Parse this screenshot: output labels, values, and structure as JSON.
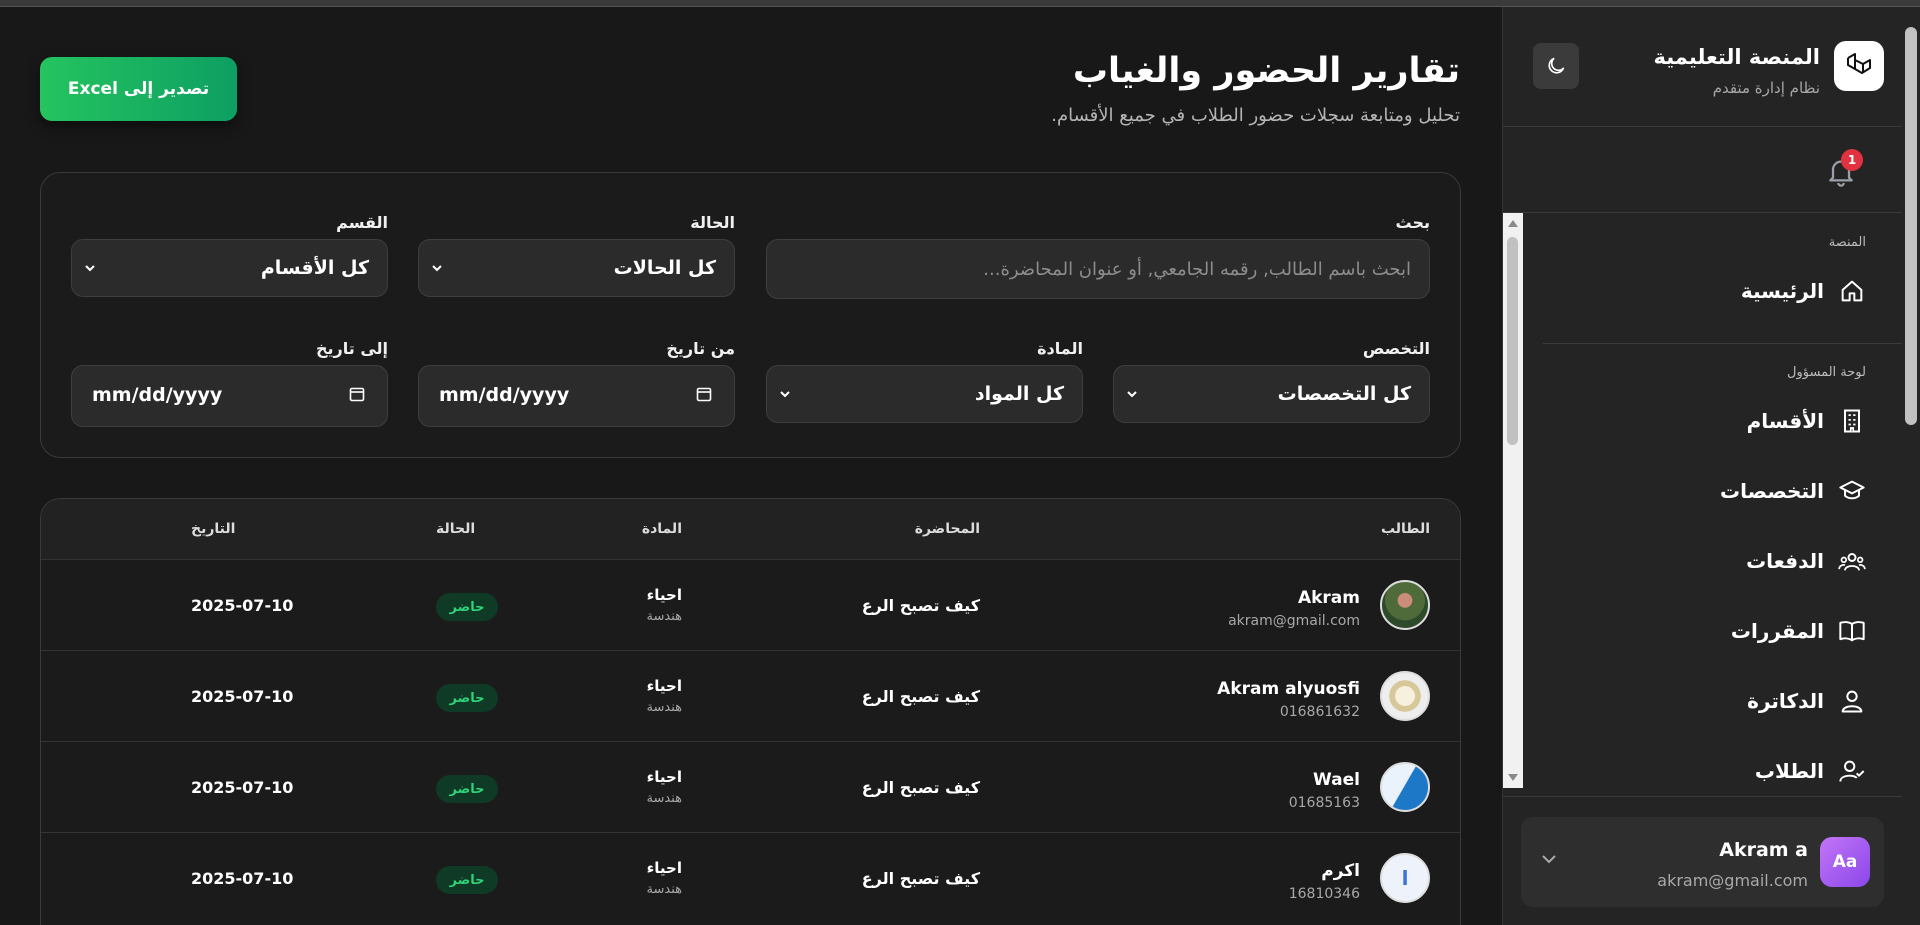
{
  "app": {
    "brand_title": "المنصة التعليمية",
    "brand_subtitle": "نظام إدارة متقدم",
    "notification_count": "1"
  },
  "nav": {
    "section_platform": "المنصة",
    "home": "الرئيسية",
    "section_admin": "لوحة المسؤول",
    "departments": "الأقسام",
    "specializations": "التخصصات",
    "batches": "الدفعات",
    "courses": "المقررات",
    "doctors": "الدكاترة",
    "students": "الطلاب"
  },
  "user": {
    "initials": "Aa",
    "name": "Akram a",
    "email": "akram@gmail.com"
  },
  "page": {
    "title": "تقارير الحضور والغياب",
    "subtitle": "تحليل ومتابعة سجلات حضور الطلاب في جميع الأقسام.",
    "export_label": "تصدير إلى Excel"
  },
  "filters": {
    "search_label": "بحث",
    "search_placeholder": "ابحث باسم الطالب, رقمه الجامعي, أو عنوان المحاضرة...",
    "status_label": "الحالة",
    "status_value": "كل الحالات",
    "department_label": "القسم",
    "department_value": "كل الأقسام",
    "specialization_label": "التخصص",
    "specialization_value": "كل التخصصات",
    "subject_label": "المادة",
    "subject_value": "كل المواد",
    "from_label": "من تاريخ",
    "from_value": "mm/dd/yyyy",
    "to_label": "إلى تاريخ",
    "to_value": "mm/dd/yyyy"
  },
  "table": {
    "headers": {
      "student": "الطالب",
      "lecture": "المحاضرة",
      "subject": "المادة",
      "status": "الحالة",
      "date": "التاريخ"
    },
    "rows": [
      {
        "name": "Akram",
        "sub": "akram@gmail.com",
        "lecture": "كيف تصبح الرع",
        "subject": "احياء",
        "dept": "هندسة",
        "status": "حاضر",
        "date": "2025-07-10"
      },
      {
        "name": "Akram alyuosfi",
        "sub": "016861632",
        "lecture": "كيف تصبح الرع",
        "subject": "احياء",
        "dept": "هندسة",
        "status": "حاضر",
        "date": "2025-07-10"
      },
      {
        "name": "Wael",
        "sub": "01685163",
        "lecture": "كيف تصبح الرع",
        "subject": "احياء",
        "dept": "هندسة",
        "status": "حاضر",
        "date": "2025-07-10"
      },
      {
        "name": "اكرم",
        "sub": "16810346",
        "avatar_letter": "ا",
        "lecture": "كيف تصبح الرع",
        "subject": "احياء",
        "dept": "هندسة",
        "status": "حاضر",
        "date": "2025-07-10"
      }
    ]
  },
  "colors": {
    "accent_green": "#17b35f",
    "status_green": "#31d37a",
    "badge_red": "#e0333f",
    "avatar_purple": "#a95ef2"
  }
}
